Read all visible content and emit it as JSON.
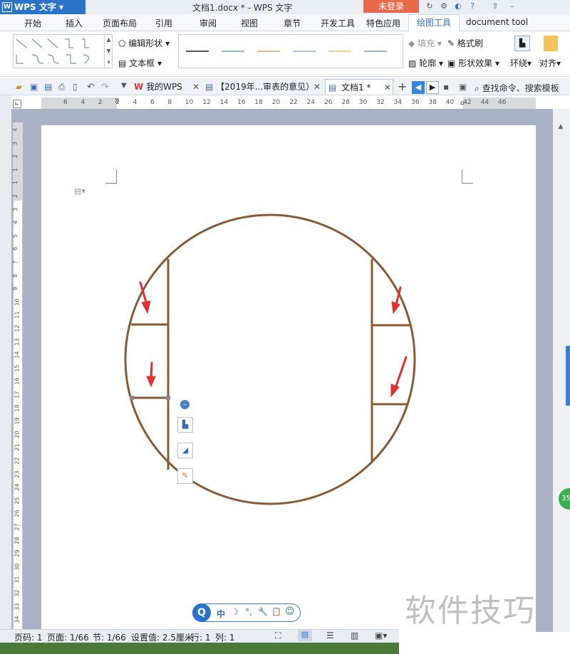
{
  "app": {
    "logo": "WPS 文字",
    "title": "文档1.docx * - WPS 文字",
    "login": "未登录"
  },
  "menu": [
    "开始",
    "插入",
    "页面布局",
    "引用",
    "审阅",
    "视图",
    "章节",
    "开发工具",
    "特色应用",
    "绘图工具",
    "document tool"
  ],
  "ribbon": {
    "edit_shape": "编辑形状",
    "textbox": "文本框",
    "fill": "填充",
    "format_brush": "格式刷",
    "outline": "轮廓",
    "shape_effect": "形状效果",
    "wrap": "环绕",
    "align": "对齐",
    "line_colors": [
      "#222222",
      "#6a9fd6",
      "#d6a85a",
      "#8fb1cf",
      "#e0c84e",
      "#6fa0c8"
    ]
  },
  "doc_tabs": {
    "my_wps": "我的WPS",
    "doc2019": "【2019年...审表的意见）",
    "doc1": "文档1 *",
    "search": "查找命令、搜索模板"
  },
  "ruler_ticks": [
    "6",
    "4",
    "2",
    "2",
    "4",
    "6",
    "8",
    "10",
    "12",
    "14",
    "16",
    "18",
    "20",
    "22",
    "24",
    "26",
    "28",
    "30",
    "32",
    "34",
    "36",
    "38",
    "40",
    "42",
    "44",
    "46"
  ],
  "vruler_ticks": [
    "4",
    "3",
    "2",
    "1",
    "1",
    "2",
    "3",
    "4",
    "5",
    "6",
    "7",
    "8",
    "9",
    "10",
    "11",
    "12",
    "13",
    "14",
    "15",
    "16",
    "17",
    "18",
    "19",
    "20",
    "21",
    "22",
    "23",
    "24",
    "25",
    "26",
    "27",
    "28",
    "29",
    "30",
    "31",
    "32",
    "33",
    "34"
  ],
  "status": {
    "page": "页码: 1",
    "pages": "页面: 1/66",
    "section": "节: 1/66",
    "setting": "设置值: 2.5厘米",
    "row": "行: 1",
    "col": "列: 1"
  },
  "float_toolbar": [
    "中",
    "☽",
    "°,",
    "🔧",
    "📋",
    "☺"
  ],
  "badge": "35",
  "watermark": "软件技巧",
  "colors": {
    "shape_stroke": "#8a5a32",
    "arrow": "#e03030",
    "accent": "#2b73c9"
  }
}
